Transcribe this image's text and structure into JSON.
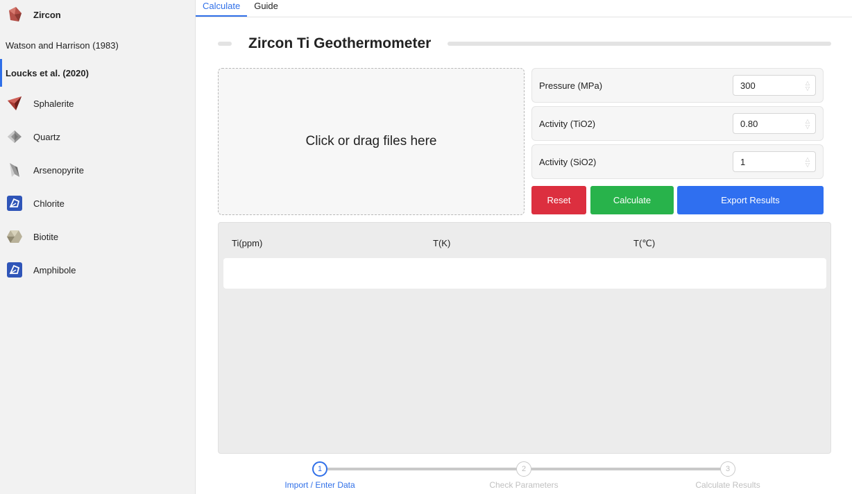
{
  "sidebar": {
    "header": {
      "label": "Zircon",
      "icon": "zircon-mineral-icon"
    },
    "sub_items": [
      {
        "label": "Watson and Harrison (1983)",
        "active": false
      },
      {
        "label": "Loucks et al. (2020)",
        "active": true
      }
    ],
    "items": [
      {
        "label": "Sphalerite",
        "icon": "sphalerite-mineral-icon"
      },
      {
        "label": "Quartz",
        "icon": "quartz-mineral-icon"
      },
      {
        "label": "Arsenopyrite",
        "icon": "arsenopyrite-mineral-icon"
      },
      {
        "label": "Chlorite",
        "icon": "chlorite-mineral-icon"
      },
      {
        "label": "Biotite",
        "icon": "biotite-mineral-icon"
      },
      {
        "label": "Amphibole",
        "icon": "amphibole-mineral-icon"
      }
    ]
  },
  "tabs": [
    {
      "label": "Calculate",
      "active": true
    },
    {
      "label": "Guide",
      "active": false
    }
  ],
  "page": {
    "title": "Zircon Ti Geothermometer"
  },
  "dropzone": {
    "text": "Click or drag files here"
  },
  "params": [
    {
      "label": "Pressure (MPa)",
      "value": "300"
    },
    {
      "label": "Activity (TiO2)",
      "value": "0.80"
    },
    {
      "label": "Activity (SiO2)",
      "value": "1"
    }
  ],
  "buttons": {
    "reset": "Reset",
    "calculate": "Calculate",
    "export": "Export Results"
  },
  "table": {
    "columns": [
      "Ti(ppm)",
      "T(K)",
      "T(℃)"
    ],
    "rows": []
  },
  "stepper": {
    "steps": [
      {
        "number": "1",
        "label": "Import / Enter Data",
        "active": true
      },
      {
        "number": "2",
        "label": "Check Parameters",
        "active": false
      },
      {
        "number": "3",
        "label": "Calculate Results",
        "active": false
      }
    ]
  },
  "colors": {
    "accent": "#2f6fe8",
    "reset": "#dc2f3f",
    "calculate": "#28b34b",
    "export": "#2f6ff0"
  }
}
